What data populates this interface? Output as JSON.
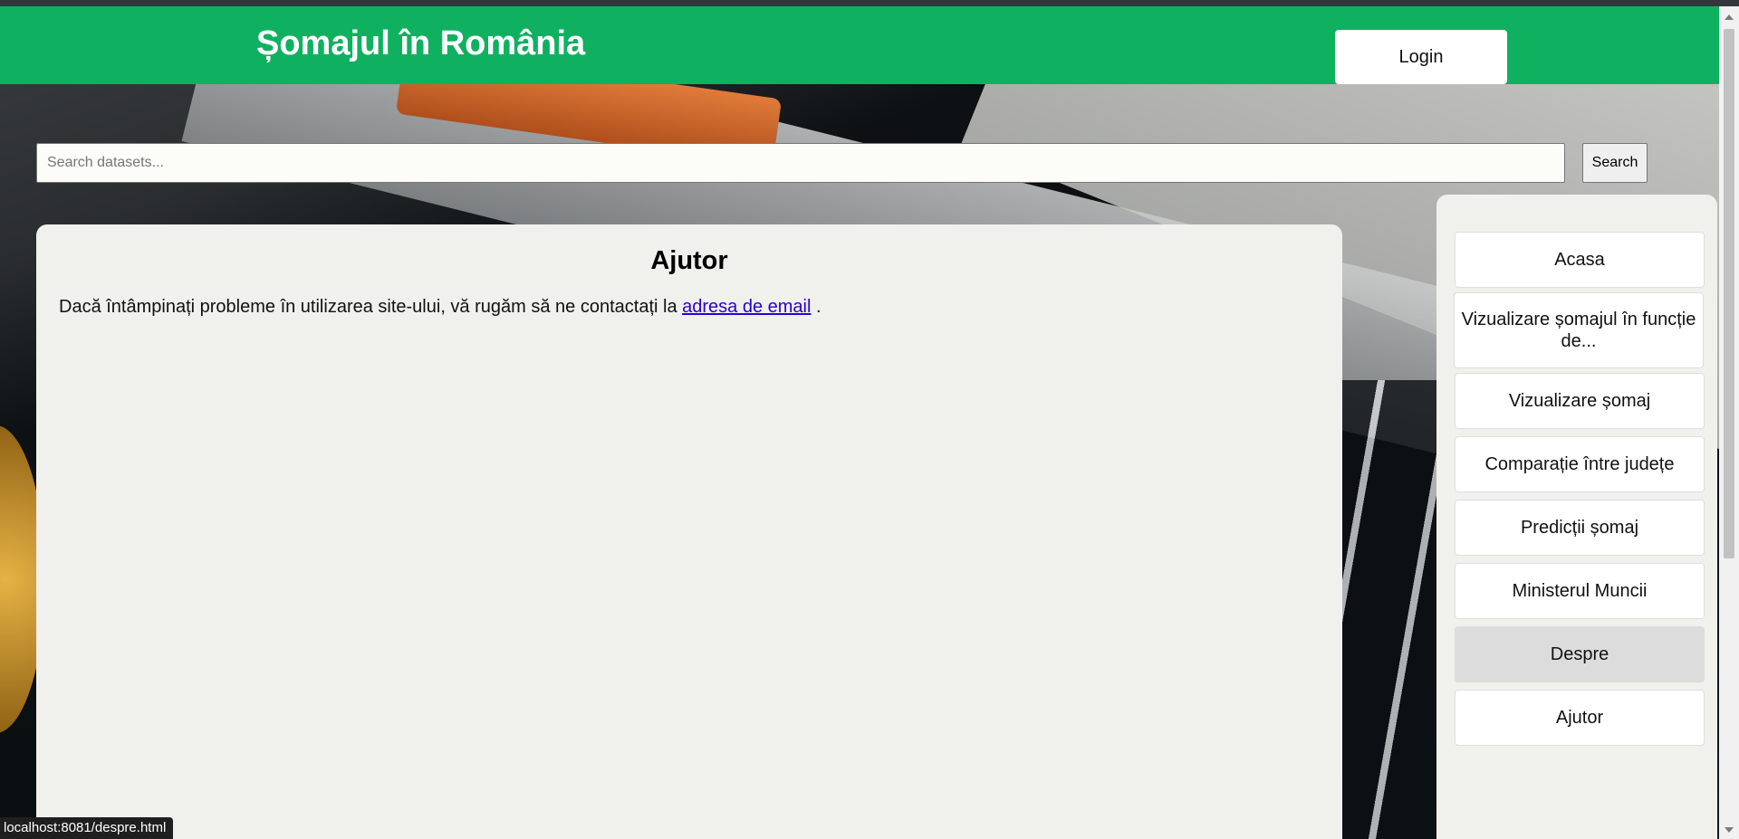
{
  "header": {
    "site_title": "Șomajul în România",
    "login_label": "Login"
  },
  "search": {
    "placeholder": "Search datasets...",
    "value": "",
    "button_label": "Search"
  },
  "main": {
    "title": "Ajutor",
    "text_before_link": "Dacă întâmpinați probleme în utilizarea site-ului, vă rugăm să ne contactați la ",
    "link_label": "adresa de email",
    "text_after_link": " ."
  },
  "sidebar": {
    "items": [
      {
        "label": "Acasa"
      },
      {
        "label": "Vizualizare șomajul în funcție de..."
      },
      {
        "label": "Vizualizare șomaj"
      },
      {
        "label": "Comparație între județe"
      },
      {
        "label": "Predicții șomaj"
      },
      {
        "label": "Ministerul Muncii"
      },
      {
        "label": "Despre"
      },
      {
        "label": "Ajutor"
      }
    ],
    "active_item": "Despre"
  },
  "status_bar": {
    "url": "localhost:8081/despre.html"
  },
  "colors": {
    "header_bg": "#0fb161",
    "panel_bg": "#f0f0ed",
    "link": "#2a00d4",
    "active_nav_bg": "#dcdcdc"
  }
}
